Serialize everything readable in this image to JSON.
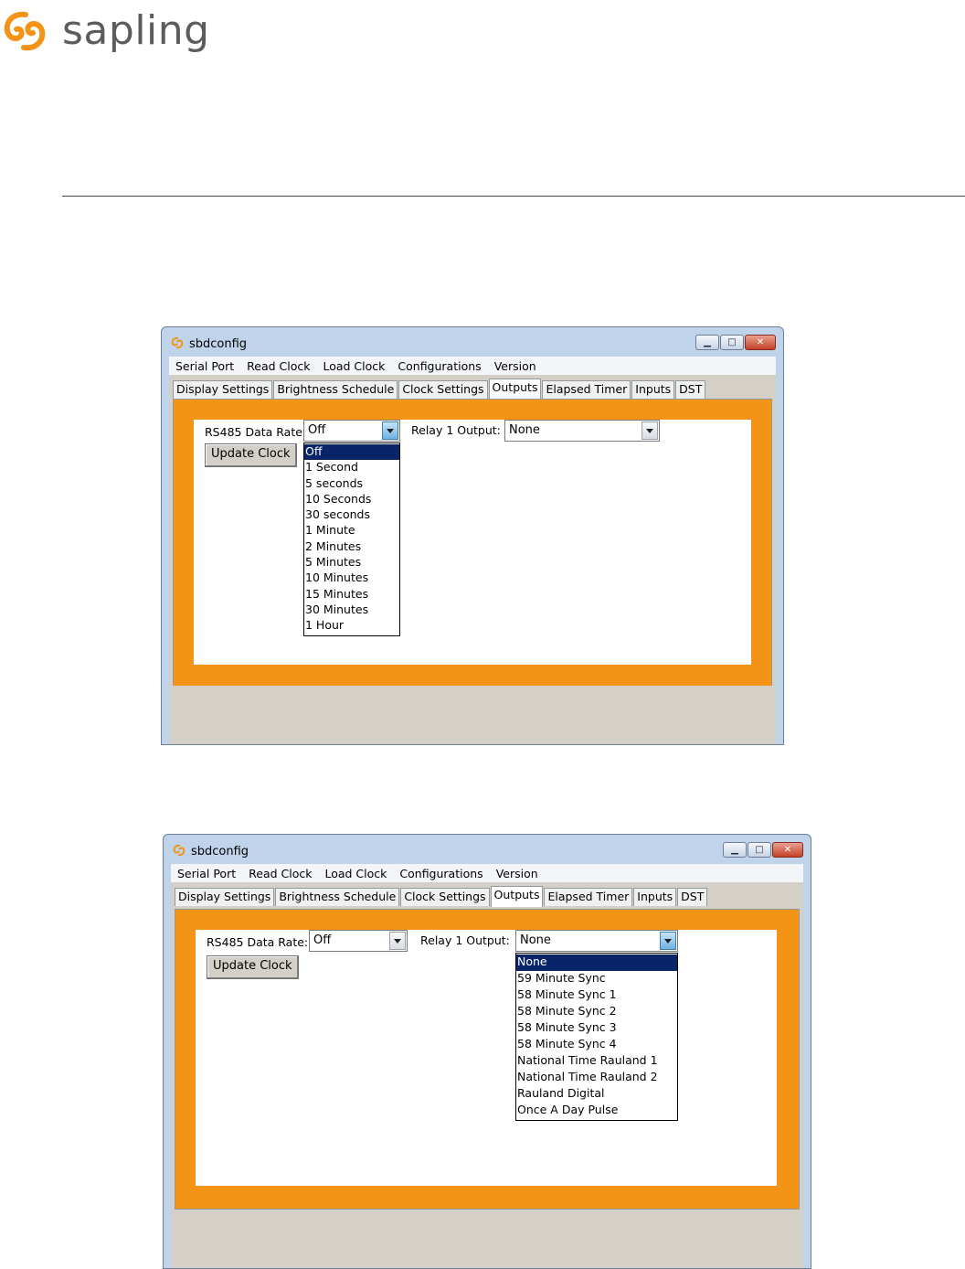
{
  "brand": {
    "name": "sapling"
  },
  "windows": [
    {
      "title": "sbdconfig",
      "menu": [
        "Serial Port",
        "Read Clock",
        "Load Clock",
        "Configurations",
        "Version"
      ],
      "tabs": [
        "Display Settings",
        "Brightness Schedule",
        "Clock Settings",
        "Outputs",
        "Elapsed Timer",
        "Inputs",
        "DST"
      ],
      "active_tab": "Outputs",
      "rs485_label": "RS485 Data Rate:",
      "rs485_value": "Off",
      "relay_label": "Relay 1 Output:",
      "relay_value": "None",
      "update_button": "Update Clock",
      "open_dropdown": "rs485",
      "dropdown_items": [
        "Off",
        "1 Second",
        "5 seconds",
        "10 Seconds",
        "30 seconds",
        "1 Minute",
        "2 Minutes",
        "5 Minutes",
        "10 Minutes",
        "15 Minutes",
        "30 Minutes",
        "1 Hour"
      ],
      "selected_item": "Off"
    },
    {
      "title": "sbdconfig",
      "menu": [
        "Serial Port",
        "Read Clock",
        "Load Clock",
        "Configurations",
        "Version"
      ],
      "tabs": [
        "Display Settings",
        "Brightness Schedule",
        "Clock Settings",
        "Outputs",
        "Elapsed Timer",
        "Inputs",
        "DST"
      ],
      "active_tab": "Outputs",
      "rs485_label": "RS485 Data Rate:",
      "rs485_value": "Off",
      "relay_label": "Relay 1 Output:",
      "relay_value": "None",
      "update_button": "Update Clock",
      "open_dropdown": "relay",
      "dropdown_items": [
        "None",
        "59 Minute Sync",
        "58 Minute Sync 1",
        "58 Minute Sync 2",
        "58 Minute Sync 3",
        "58 Minute Sync 4",
        "National Time Rauland 1",
        "National Time Rauland 2",
        "Rauland Digital",
        "Once A Day Pulse"
      ],
      "selected_item": "None"
    }
  ],
  "colors": {
    "accent_orange": "#f39416",
    "selection": "#0a246a",
    "brand_orange": "#f39416",
    "brand_gray": "#5c5c5c"
  }
}
